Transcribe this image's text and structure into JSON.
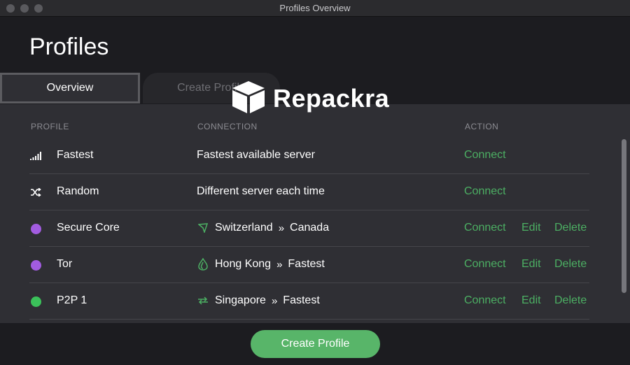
{
  "window": {
    "title": "Profiles Overview"
  },
  "header": {
    "title": "Profiles"
  },
  "tabs": [
    {
      "label": "Overview",
      "active": true
    },
    {
      "label": "Create Profile",
      "active": false
    }
  ],
  "watermark": {
    "text": "Repackra"
  },
  "table": {
    "columns": [
      "PROFILE",
      "CONNECTION",
      "ACTION"
    ],
    "rows": [
      {
        "icon": "signal-bars-icon",
        "name": "Fastest",
        "connection": "Fastest available server",
        "actions": [
          "Connect"
        ]
      },
      {
        "icon": "shuffle-icon",
        "name": "Random",
        "connection": "Different server each time",
        "actions": [
          "Connect"
        ]
      },
      {
        "icon": "purple-dot",
        "name": "Secure Core",
        "conn_icon": "secure-core-icon",
        "from": "Switzerland",
        "to": "Canada",
        "actions": [
          "Connect",
          "Edit",
          "Delete"
        ]
      },
      {
        "icon": "purple-dot",
        "name": "Tor",
        "conn_icon": "tor-onion-icon",
        "from": "Hong Kong",
        "to": "Fastest",
        "actions": [
          "Connect",
          "Edit",
          "Delete"
        ]
      },
      {
        "icon": "green-dot",
        "name": "P2P 1",
        "conn_icon": "p2p-arrows-icon",
        "from": "Singapore",
        "to": "Fastest",
        "actions": [
          "Connect",
          "Edit",
          "Delete"
        ]
      }
    ]
  },
  "footer": {
    "create_label": "Create Profile"
  },
  "colors": {
    "accent": "#58b569",
    "action_text": "#4caf63",
    "purple": "#a25ce0",
    "green": "#3bc15a",
    "panel": "#2f2f34",
    "background": "#1c1c20"
  }
}
